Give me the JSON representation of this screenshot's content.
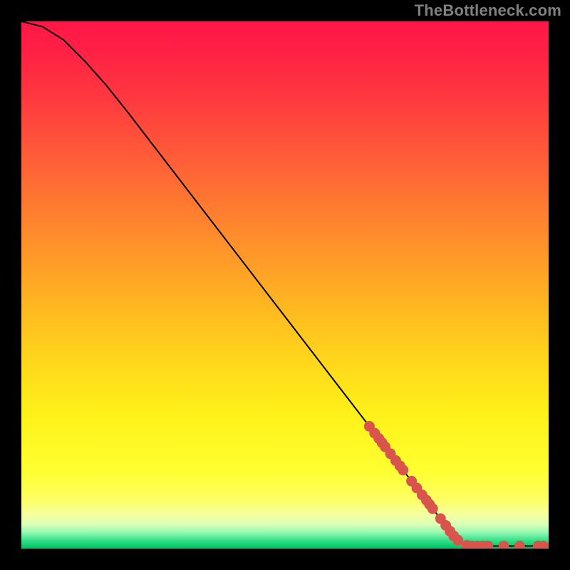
{
  "watermark": "TheBottleneck.com",
  "chart_data": {
    "type": "line",
    "title": "",
    "xlabel": "",
    "ylabel": "",
    "xlim": [
      0,
      100
    ],
    "ylim": [
      0,
      100
    ],
    "grid": false,
    "curve": [
      {
        "x": 0,
        "y": 100.0
      },
      {
        "x": 4,
        "y": 99.0
      },
      {
        "x": 8,
        "y": 96.5
      },
      {
        "x": 12,
        "y": 92.5
      },
      {
        "x": 16,
        "y": 88.0
      },
      {
        "x": 20,
        "y": 83.0
      },
      {
        "x": 25,
        "y": 76.5
      },
      {
        "x": 30,
        "y": 70.0
      },
      {
        "x": 35,
        "y": 63.5
      },
      {
        "x": 40,
        "y": 57.0
      },
      {
        "x": 45,
        "y": 50.5
      },
      {
        "x": 50,
        "y": 44.0
      },
      {
        "x": 55,
        "y": 37.5
      },
      {
        "x": 60,
        "y": 31.0
      },
      {
        "x": 65,
        "y": 24.5
      },
      {
        "x": 70,
        "y": 18.0
      },
      {
        "x": 75,
        "y": 11.5
      },
      {
        "x": 80,
        "y": 5.0
      },
      {
        "x": 83,
        "y": 1.5
      },
      {
        "x": 85,
        "y": 0.5
      },
      {
        "x": 90,
        "y": 0.5
      },
      {
        "x": 95,
        "y": 0.5
      },
      {
        "x": 100,
        "y": 0.5
      }
    ],
    "markers": [
      {
        "x": 66.0,
        "y": 23.2
      },
      {
        "x": 67.0,
        "y": 21.9
      },
      {
        "x": 67.8,
        "y": 20.9
      },
      {
        "x": 68.4,
        "y": 20.1
      },
      {
        "x": 69.0,
        "y": 19.3
      },
      {
        "x": 70.0,
        "y": 18.0
      },
      {
        "x": 71.0,
        "y": 16.7
      },
      {
        "x": 71.8,
        "y": 15.7
      },
      {
        "x": 72.4,
        "y": 14.9
      },
      {
        "x": 74.0,
        "y": 12.8
      },
      {
        "x": 75.0,
        "y": 11.5
      },
      {
        "x": 76.0,
        "y": 10.2
      },
      {
        "x": 76.8,
        "y": 9.2
      },
      {
        "x": 77.4,
        "y": 8.4
      },
      {
        "x": 78.0,
        "y": 7.6
      },
      {
        "x": 79.5,
        "y": 5.7
      },
      {
        "x": 80.5,
        "y": 4.4
      },
      {
        "x": 81.3,
        "y": 3.3
      },
      {
        "x": 82.0,
        "y": 2.4
      },
      {
        "x": 82.8,
        "y": 1.6
      },
      {
        "x": 84.5,
        "y": 0.6
      },
      {
        "x": 85.5,
        "y": 0.5
      },
      {
        "x": 86.5,
        "y": 0.5
      },
      {
        "x": 87.5,
        "y": 0.5
      },
      {
        "x": 88.5,
        "y": 0.5
      },
      {
        "x": 91.5,
        "y": 0.5
      },
      {
        "x": 94.5,
        "y": 0.5
      },
      {
        "x": 98.0,
        "y": 0.5
      },
      {
        "x": 99.0,
        "y": 0.5
      }
    ],
    "gradient_stops": [
      {
        "offset": 0.0,
        "color": "#ff1846"
      },
      {
        "offset": 0.05,
        "color": "#ff1f45"
      },
      {
        "offset": 0.15,
        "color": "#ff3a3f"
      },
      {
        "offset": 0.25,
        "color": "#ff5a38"
      },
      {
        "offset": 0.35,
        "color": "#ff7a30"
      },
      {
        "offset": 0.45,
        "color": "#ff9a28"
      },
      {
        "offset": 0.55,
        "color": "#ffba20"
      },
      {
        "offset": 0.65,
        "color": "#ffd81a"
      },
      {
        "offset": 0.75,
        "color": "#fff21a"
      },
      {
        "offset": 0.85,
        "color": "#ffff30"
      },
      {
        "offset": 0.905,
        "color": "#feff60"
      },
      {
        "offset": 0.935,
        "color": "#f6ffa0"
      },
      {
        "offset": 0.955,
        "color": "#d8ffb8"
      },
      {
        "offset": 0.97,
        "color": "#90f8b0"
      },
      {
        "offset": 0.985,
        "color": "#30e088"
      },
      {
        "offset": 1.0,
        "color": "#00c060"
      }
    ],
    "curve_color": "#000000",
    "marker_color": "#d9544d",
    "marker_radius_px": 7.5
  }
}
